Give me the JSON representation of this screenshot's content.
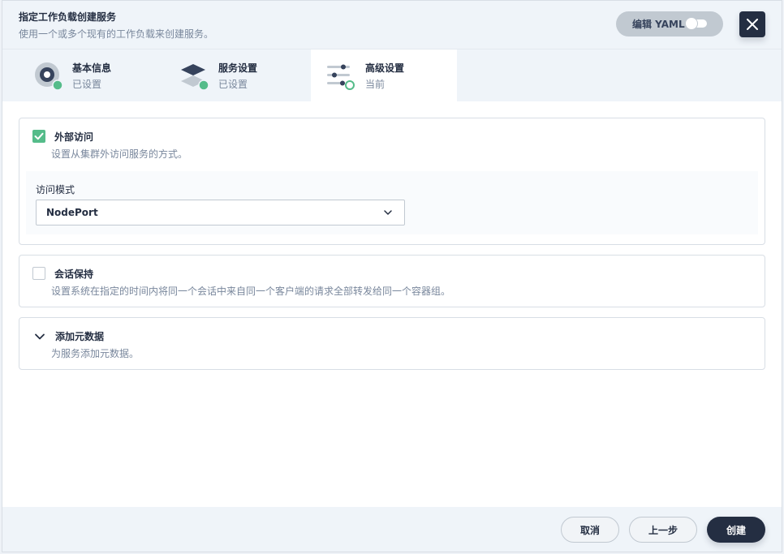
{
  "header": {
    "title": "指定工作负载创建服务",
    "description": "使用一个或多个现有的工作负载来创建服务。",
    "yaml_label": "编辑 YAML"
  },
  "steps": [
    {
      "name": "基本信息",
      "status": "已设置",
      "icon": "basic-info-icon"
    },
    {
      "name": "服务设置",
      "status": "已设置",
      "icon": "layers-icon"
    },
    {
      "name": "高级设置",
      "status": "当前",
      "icon": "sliders-icon"
    }
  ],
  "external_access": {
    "title": "外部访问",
    "description": "设置从集群外访问服务的方式。",
    "checked": true,
    "mode_label": "访问模式",
    "mode_value": "NodePort"
  },
  "session_affinity": {
    "title": "会话保持",
    "description": "设置系统在指定的时间内将同一个会话中来自同一个客户端的请求全部转发给同一个容器组。",
    "checked": false
  },
  "metadata": {
    "title": "添加元数据",
    "description": "为服务添加元数据。"
  },
  "footer": {
    "cancel": "取消",
    "prev": "上一步",
    "create": "创建"
  },
  "colors": {
    "accent_green": "#55bc8a",
    "dark": "#242e42",
    "muted": "#79879c"
  }
}
